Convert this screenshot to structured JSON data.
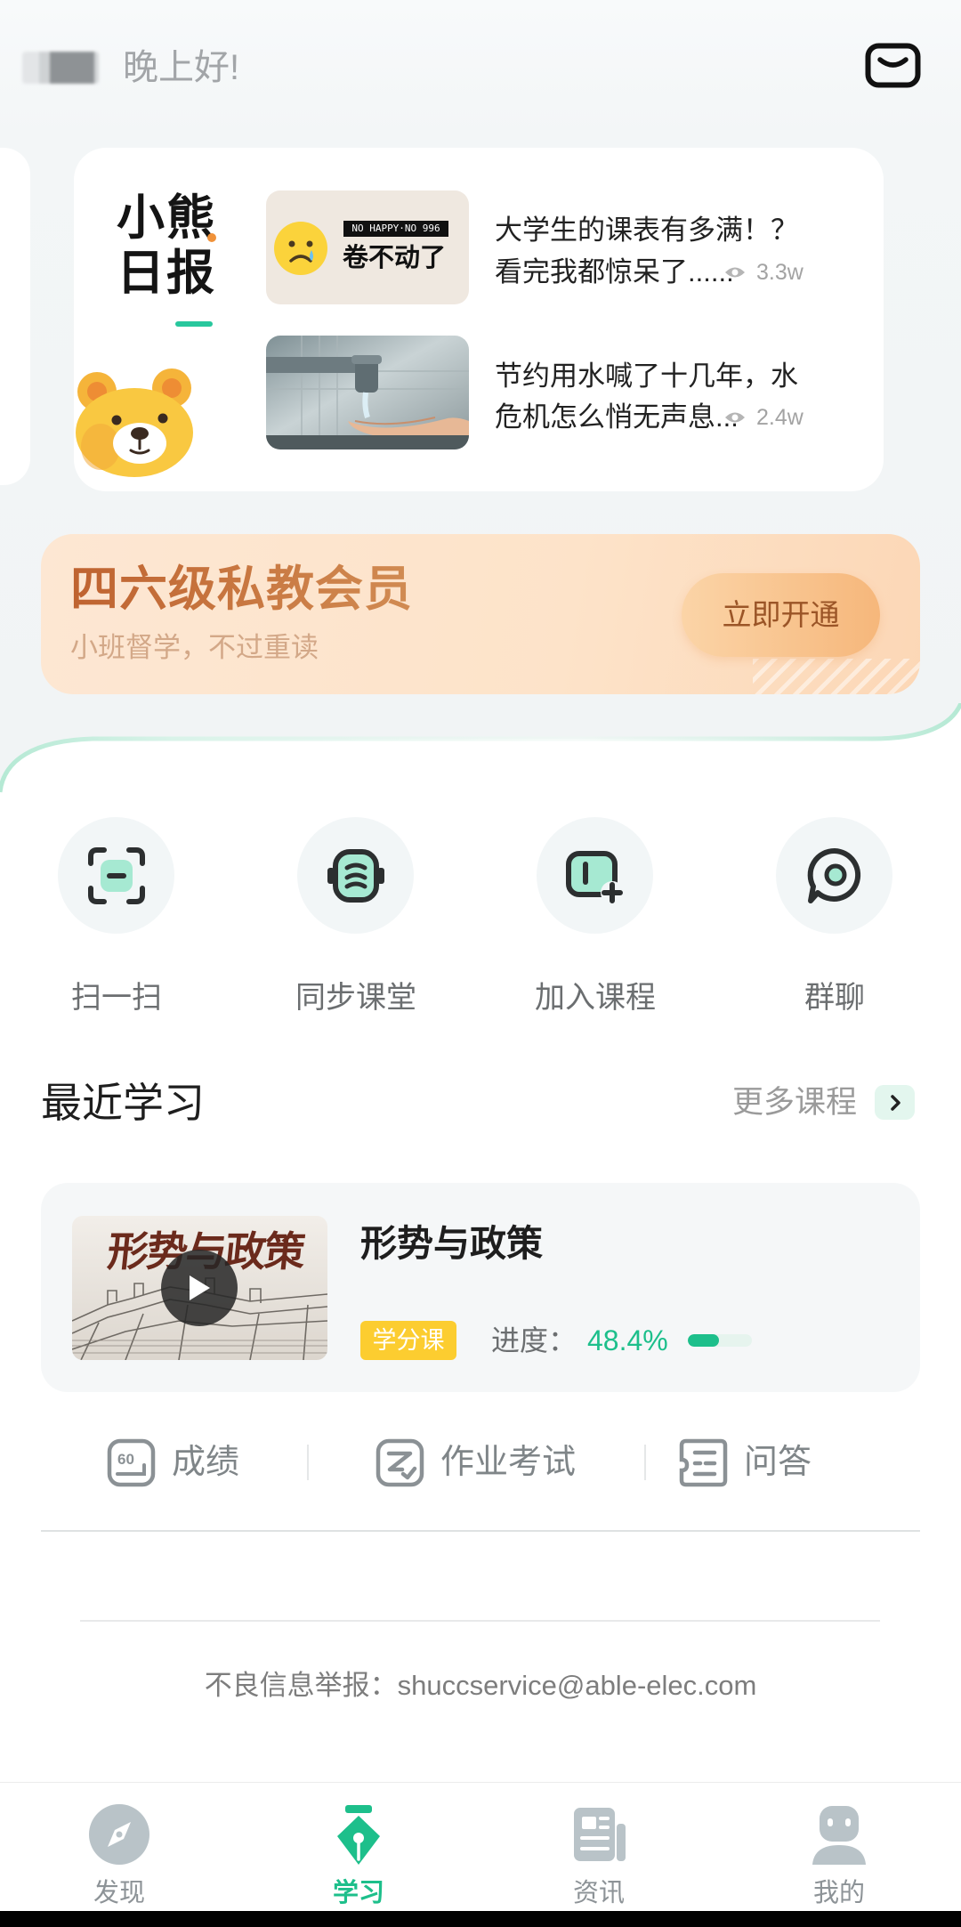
{
  "colors": {
    "accent": "#1dbf8b",
    "text_primary": "#222222",
    "text_secondary": "#999999",
    "banner_title": "#c46d36",
    "badge": "#fccd30",
    "nav_inactive": "#b9c3c8",
    "icon_mint": "#a6e9d2"
  },
  "header": {
    "greeting": "晚上好!",
    "mail_icon": "mail-icon"
  },
  "daily_news": {
    "logo_line1": "小熊",
    "logo_line2": "日报",
    "mascot": "bear-mascot",
    "articles": [
      {
        "thumb_tag": "NO HAPPY·NO 996",
        "thumb_caption": "卷不动了",
        "title_line1": "大学生的课表有多满！？",
        "title_line2": "看完我都惊呆了......",
        "views": "3.3w"
      },
      {
        "title_line1": "节约用水喊了十几年，水",
        "title_line2": "危机怎么悄无声息...",
        "views": "2.4w"
      }
    ]
  },
  "promo_banner": {
    "title": "四六级私教会员",
    "subtitle": "小班督学，不过重读",
    "cta": "立即开通"
  },
  "quick_actions": [
    {
      "label": "扫一扫",
      "icon": "scan-icon"
    },
    {
      "label": "同步课堂",
      "icon": "sync-class-icon"
    },
    {
      "label": "加入课程",
      "icon": "join-course-icon"
    },
    {
      "label": "群聊",
      "icon": "group-chat-icon"
    }
  ],
  "recent": {
    "title": "最近学习",
    "more": "更多课程",
    "course": {
      "thumb_title": "形势与政策",
      "title": "形势与政策",
      "badge": "学分课",
      "progress_label": "进度：",
      "progress_text": "48.4%",
      "progress_value": 0.484
    }
  },
  "course_links": [
    {
      "label": "成绩",
      "icon": "score-icon",
      "icon_text": "60"
    },
    {
      "label": "作业考试",
      "icon": "homework-exam-icon"
    },
    {
      "label": "问答",
      "icon": "qa-icon"
    }
  ],
  "footer": {
    "report": "不良信息举报：shuccservice@able-elec.com"
  },
  "bottom_nav": {
    "active": "学习",
    "items": [
      {
        "label": "发现",
        "icon": "discover-compass-icon"
      },
      {
        "label": "学习",
        "icon": "study-pen-icon"
      },
      {
        "label": "资讯",
        "icon": "news-icon"
      },
      {
        "label": "我的",
        "icon": "profile-icon"
      }
    ]
  }
}
